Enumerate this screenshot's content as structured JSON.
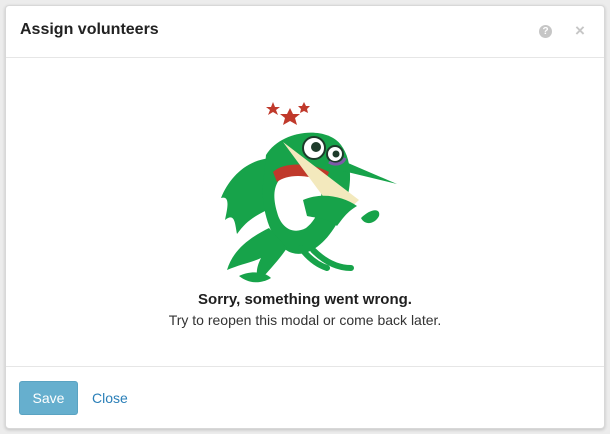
{
  "modal": {
    "title": "Assign volunteers",
    "help_icon": "question-circle-icon",
    "help_glyph": "?",
    "close_icon": "close-icon",
    "close_glyph": "×"
  },
  "error": {
    "illustration": "dizzy-green-bird-illustration",
    "title": "Sorry, something went wrong.",
    "message": "Try to reopen this modal or come back later."
  },
  "footer": {
    "save_label": "Save",
    "close_label": "Close"
  },
  "colors": {
    "primary_button": "#66afce",
    "link": "#2a7fb8",
    "bird_green": "#17a34a",
    "star_red": "#c0392b"
  }
}
